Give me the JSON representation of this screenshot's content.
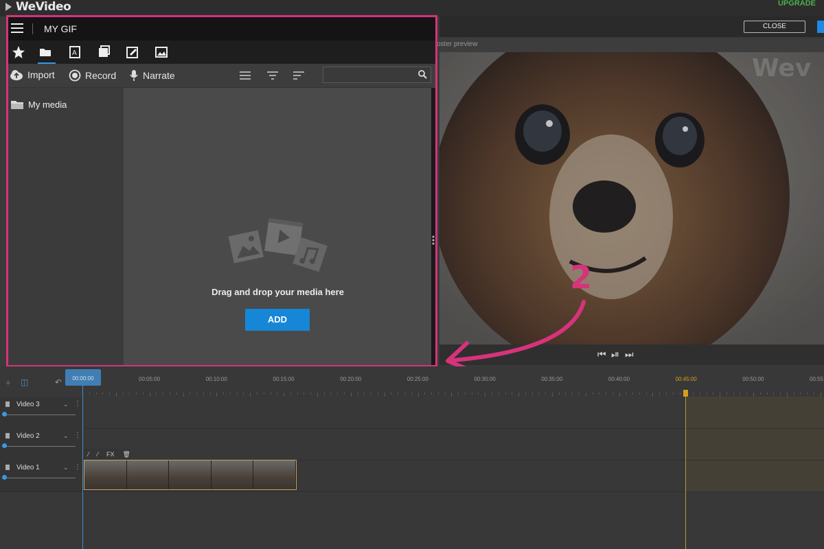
{
  "app": {
    "logo": "WeVideo",
    "upgrade_label": "UPGRADE"
  },
  "header": {
    "close_label": "CLOSE",
    "preview_label": "oster preview"
  },
  "panel": {
    "title": "MY GIF",
    "toolbar": {
      "import_label": "Import",
      "record_label": "Record",
      "narrate_label": "Narrate",
      "search_placeholder": ""
    },
    "folder_label": "My media",
    "drop_text": "Drag and drop your media here",
    "add_label": "ADD"
  },
  "annotation": {
    "step_number": "2"
  },
  "timeline": {
    "playhead_time": "00:00:00",
    "ticks": [
      "00:05:00",
      "00:10:00",
      "00:15:00",
      "00:20:00",
      "00:25:00",
      "00:30:00",
      "00:35:00",
      "00:40:00",
      "00:45:00",
      "00:50:00",
      "00:55"
    ],
    "highlight_tick_index": 8,
    "clip_tools": [
      "FX"
    ],
    "tracks": [
      {
        "name": "Video 3"
      },
      {
        "name": "Video 2"
      },
      {
        "name": "Video 1"
      }
    ]
  },
  "colors": {
    "accent": "#d6337b",
    "button_blue": "#1687d6",
    "playhead": "#3f8fd0",
    "end_marker": "#d4a017"
  },
  "icons": [
    "hamburger-icon",
    "star-icon",
    "folder-icon",
    "text-icon",
    "add-media-icon",
    "edit-icon",
    "image-icon",
    "upload-icon",
    "record-icon",
    "microphone-icon",
    "list-icon",
    "filter-icon",
    "sort-icon",
    "search-icon",
    "play-icon",
    "prev-icon",
    "next-icon",
    "trash-icon"
  ]
}
